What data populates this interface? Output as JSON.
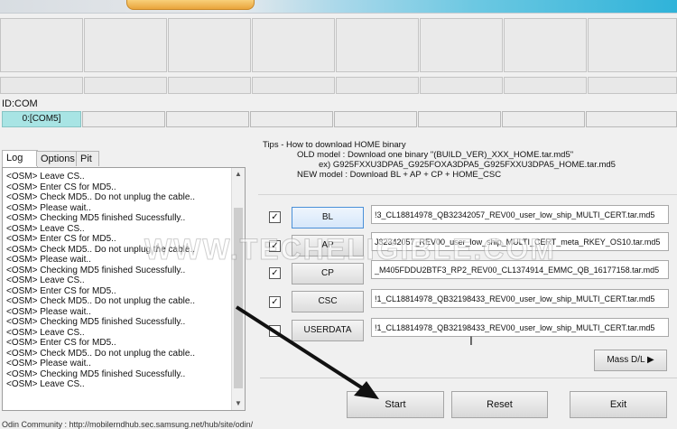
{
  "id_com_label": "ID:COM",
  "com_ports": [
    "0:[COM5]",
    "",
    "",
    "",
    "",
    "",
    "",
    ""
  ],
  "tabs": [
    "Log",
    "Options",
    "Pit"
  ],
  "log_lines": [
    "<OSM> Leave CS..",
    "<OSM> Enter CS for MD5..",
    "<OSM> Check MD5.. Do not unplug the cable..",
    "<OSM> Please wait..",
    "<OSM> Checking MD5 finished Sucessfully..",
    "<OSM> Leave CS..",
    "<OSM> Enter CS for MD5..",
    "<OSM> Check MD5.. Do not unplug the cable..",
    "<OSM> Please wait..",
    "<OSM> Checking MD5 finished Sucessfully..",
    "<OSM> Leave CS..",
    "<OSM> Enter CS for MD5..",
    "<OSM> Check MD5.. Do not unplug the cable..",
    "<OSM> Please wait..",
    "<OSM> Checking MD5 finished Sucessfully..",
    "<OSM> Leave CS..",
    "<OSM> Enter CS for MD5..",
    "<OSM> Check MD5.. Do not unplug the cable..",
    "<OSM> Please wait..",
    "<OSM> Checking MD5 finished Sucessfully..",
    "<OSM> Leave CS.."
  ],
  "tips": {
    "title": "Tips - How to download HOME binary",
    "old_model": "OLD model  : Download one binary    \"(BUILD_VER)_XXX_HOME.tar.md5\"",
    "example": "ex) G925FXXU3DPA5_G925FOXA3DPA5_G925FXXU3DPA5_HOME.tar.md5",
    "new_model": "NEW model : Download BL + AP + CP + HOME_CSC"
  },
  "files": [
    {
      "label": "BL",
      "checked": true,
      "path": "!3_CL18814978_QB32342057_REV00_user_low_ship_MULTI_CERT.tar.md5"
    },
    {
      "label": "AP",
      "checked": true,
      "path": "J32342057_REV00_user_low_ship_MULTI_CERT_meta_RKEY_OS10.tar.md5"
    },
    {
      "label": "CP",
      "checked": true,
      "path": "_M405FDDU2BTF3_RP2_REV00_CL1374914_EMMC_QB_16177158.tar.md5"
    },
    {
      "label": "CSC",
      "checked": true,
      "path": "!1_CL18814978_QB32198433_REV00_user_low_ship_MULTI_CERT.tar.md5"
    },
    {
      "label": "USERDATA",
      "checked": false,
      "path": "!1_CL18814978_QB32198433_REV00_user_low_ship_MULTI_CERT.tar.md5"
    }
  ],
  "mass_dl": "Mass D/L ▶",
  "actions": {
    "start": "Start",
    "reset": "Reset",
    "exit": "Exit"
  },
  "footer": "Odin Community : http://mobilerndhub.sec.samsung.net/hub/site/odin/",
  "watermark": "WWW.TECHELIGIBLE.COM",
  "colors": {
    "active_com": "#a8e4e4",
    "bl_button_border": "#4a90d8"
  }
}
